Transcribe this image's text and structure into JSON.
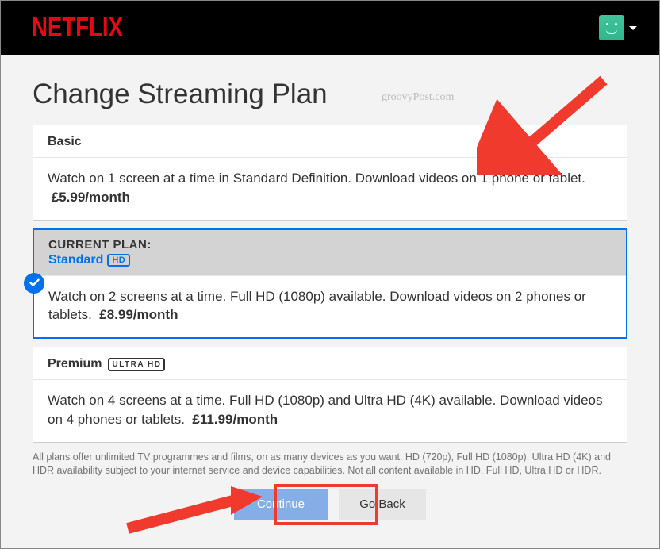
{
  "brand": "NETFLIX",
  "page_title": "Change Streaming Plan",
  "watermark": "groovyPost.com",
  "plans": {
    "basic": {
      "name": "Basic",
      "desc": "Watch on 1 screen at a time in Standard Definition. Download videos on 1 phone or tablet.",
      "price": "£5.99/month"
    },
    "standard": {
      "current_label": "CURRENT PLAN:",
      "name": "Standard",
      "badge": "HD",
      "desc": "Watch on 2 screens at a time. Full HD (1080p) available. Download videos on 2 phones or tablets.",
      "price": "£8.99/month"
    },
    "premium": {
      "name": "Premium",
      "badge": "ULTRA HD",
      "desc": "Watch on 4 screens at a time. Full HD (1080p) and Ultra HD (4K) available. Download videos on 4 phones or tablets.",
      "price": "£11.99/month"
    }
  },
  "footnote": "All plans offer unlimited TV programmes and films, on as many devices as you want. HD (720p), Full HD (1080p), Ultra HD (4K) and HDR availability subject to your internet service and device capabilities. Not all content available in HD, Full HD, Ultra HD or HDR.",
  "buttons": {
    "continue": "Continue",
    "go_back": "Go Back"
  }
}
